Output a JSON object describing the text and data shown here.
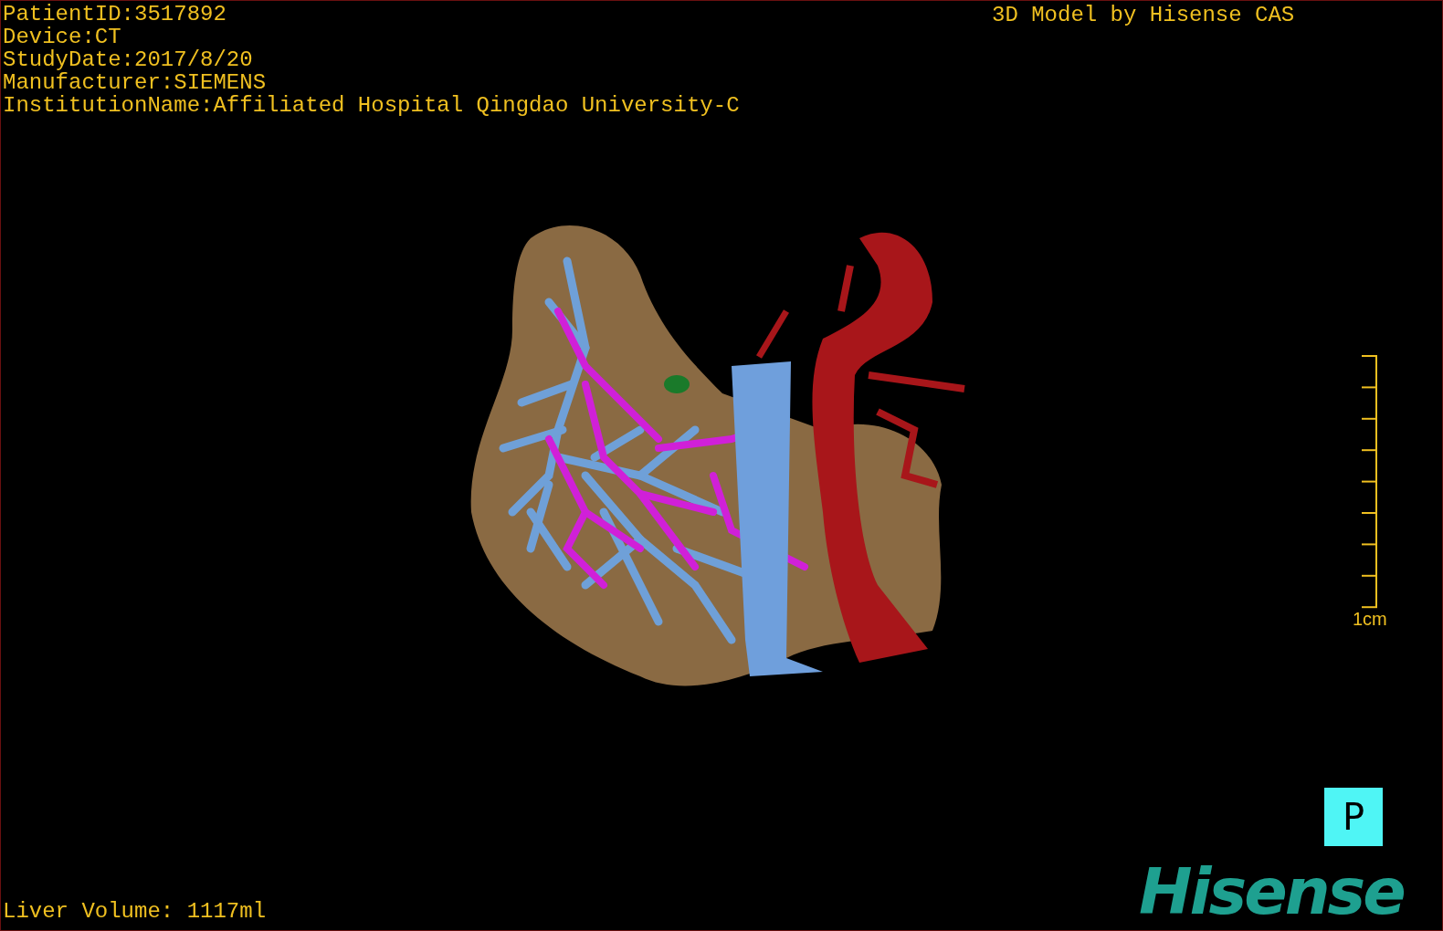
{
  "patient_info": [
    "PatientID:3517892",
    "Device:CT",
    "StudyDate:2017/8/20",
    "Manufacturer:SIEMENS",
    "InstitutionName:Affiliated Hospital Qingdao University-C"
  ],
  "model_credit": "3D Model by Hisense CAS",
  "scale_bar": {
    "label": "1cm"
  },
  "orientation_marker": "P",
  "logo": "Hisense",
  "liver_volume": "Liver Volume: 1117ml"
}
